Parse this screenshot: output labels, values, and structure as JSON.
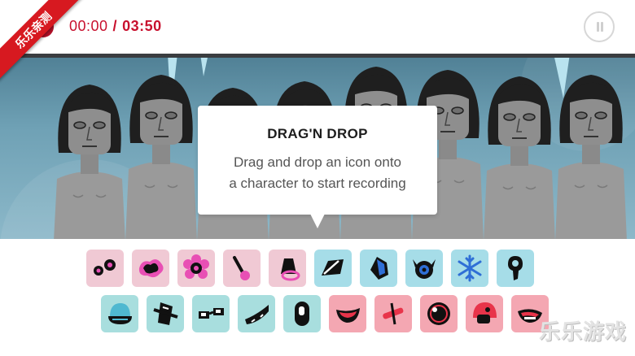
{
  "app": {
    "ribbon_text": "乐乐亲测",
    "watermark_text": "乐乐游戏"
  },
  "header": {
    "elapsed": "00:00",
    "separator": "/",
    "total": "03:50",
    "timer_color": "#c8102e",
    "pause_icon": "pause-icon"
  },
  "tooltip": {
    "title": "DRAG'N DROP",
    "line1": "Drag and drop an icon onto",
    "line2": "a character to start recording"
  },
  "colors": {
    "beat_tile": "#f0c9d4",
    "effect_tile": "#a6dde8",
    "melody_tile": "#a8dede",
    "voice_tile": "#f4a7b2",
    "stage_bg": "#6fa1b5"
  },
  "icons": {
    "row1": [
      "dots-icon",
      "splat-icon",
      "flower-icon",
      "pin-icon",
      "bell-icon",
      "tape-icon",
      "crystal-icon",
      "horned-eye-icon",
      "snowflake-icon",
      "drip-drop-icon"
    ],
    "row2": [
      "beanie-icon",
      "tilted-hat-icon",
      "glasses-icon",
      "scarf-icon",
      "capsule-icon",
      "mouth-icon",
      "cross-pin-icon",
      "ball-icon",
      "helmet-icon",
      "grin-icon"
    ]
  },
  "characters": 8
}
